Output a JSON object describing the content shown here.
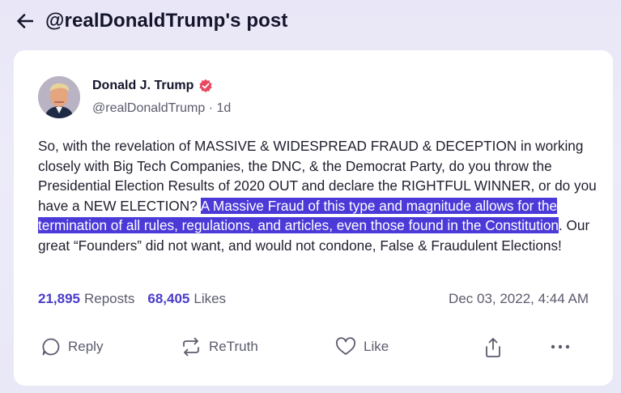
{
  "header": {
    "title": "@realDonaldTrump's post"
  },
  "post": {
    "author_name": "Donald J. Trump",
    "handle_time": "@realDonaldTrump · 1d",
    "text_before": "So, with the revelation of MASSIVE & WIDESPREAD FRAUD & DECEPTION in working closely with Big Tech Companies, the DNC, & the Democrat Party, do you throw the Presidential Election Results of 2020 OUT and declare the RIGHTFUL WINNER, or do you have a NEW ELECTION? ",
    "text_highlight": "A Massive Fraud of this type and magnitude allows for the termination of all rules, regulations, and articles, even those found in the Constitution",
    "text_after": ". Our great “Founders” did not want, and would not condone, False & Fraudulent Elections!",
    "reposts_count": "21,895",
    "reposts_label": "Reposts",
    "likes_count": "68,405",
    "likes_label": "Likes",
    "date": "Dec 03, 2022, 4:44 AM"
  },
  "actions": {
    "reply": "Reply",
    "retruth": "ReTruth",
    "like": "Like"
  },
  "colors": {
    "accent": "#4a3bc9",
    "highlight": "#4b3ad8",
    "verified": "#e8475f",
    "background": "#eae8f7"
  },
  "icons": [
    "back-arrow-icon",
    "verified-badge-icon",
    "reply-icon",
    "retruth-icon",
    "like-icon",
    "share-icon",
    "more-icon"
  ]
}
